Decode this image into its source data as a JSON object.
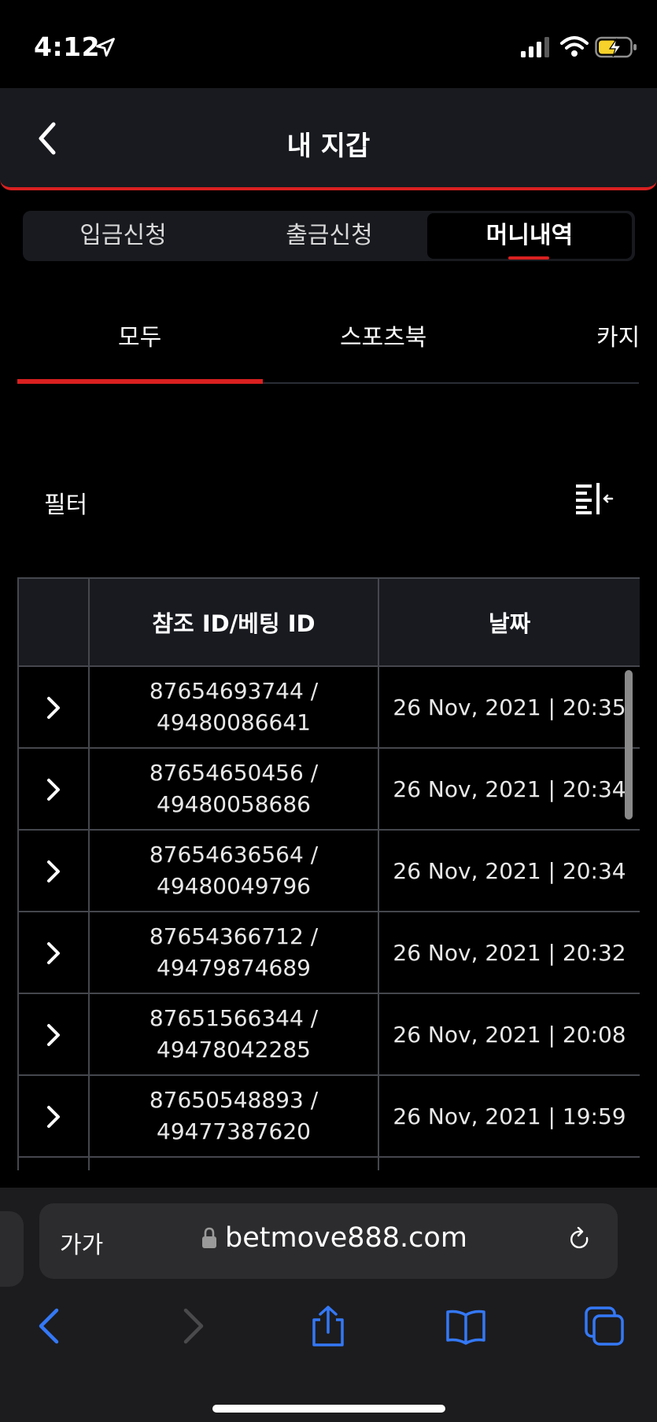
{
  "status": {
    "time": "4:12"
  },
  "header": {
    "title": "내 지갑"
  },
  "segments": [
    {
      "label": "입금신청"
    },
    {
      "label": "출금신청"
    },
    {
      "label": "머니내역"
    }
  ],
  "categories": [
    {
      "label": "모두"
    },
    {
      "label": "스포츠북"
    },
    {
      "label": "카지"
    }
  ],
  "filter": {
    "label": "필터"
  },
  "table": {
    "columns": [
      "",
      "참조 ID/베팅 ID",
      "날짜"
    ],
    "rows": [
      {
        "ref": "87654693744 /",
        "bet": "49480086641",
        "date": "26 Nov, 2021 | 20:35"
      },
      {
        "ref": "87654650456 /",
        "bet": "49480058686",
        "date": "26 Nov, 2021 | 20:34"
      },
      {
        "ref": "87654636564 /",
        "bet": "49480049796",
        "date": "26 Nov, 2021 | 20:34"
      },
      {
        "ref": "87654366712 /",
        "bet": "49479874689",
        "date": "26 Nov, 2021 | 20:32"
      },
      {
        "ref": "87651566344 /",
        "bet": "49478042285",
        "date": "26 Nov, 2021 | 20:08"
      },
      {
        "ref": "87650548893 /",
        "bet": "49477387620",
        "date": "26 Nov, 2021 | 19:59"
      }
    ]
  },
  "browser": {
    "text_size_label": "가가",
    "url": "betmove888.com"
  },
  "colors": {
    "accent": "#d92020",
    "ios_blue": "#3478f6",
    "panel": "#181a1f"
  }
}
